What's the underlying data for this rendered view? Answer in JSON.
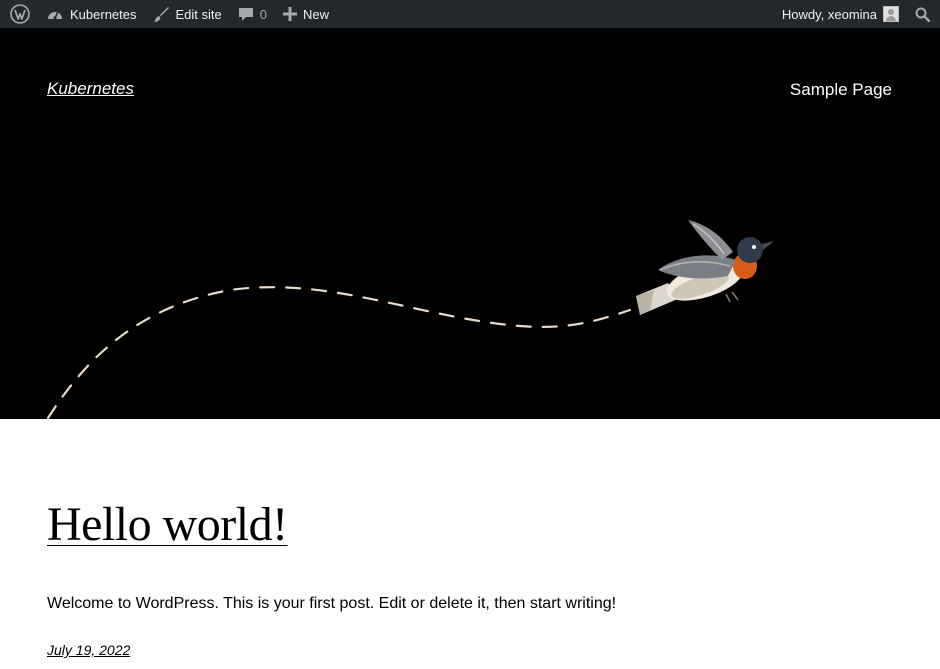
{
  "admin_bar": {
    "wp_logo_icon": "wordpress-logo-icon",
    "site_name": "Kubernetes",
    "site_icon": "dashboard-icon",
    "edit_site": "Edit site",
    "edit_icon": "brush-icon",
    "comments_count": "0",
    "comment_icon": "comment-icon",
    "new_label": "New",
    "new_icon": "plus-icon",
    "howdy": "Howdy, xeomina",
    "search_icon": "search-icon",
    "bar_color": "#23282d"
  },
  "header": {
    "site_title": "Kubernetes",
    "nav": [
      {
        "label": "Sample Page"
      }
    ],
    "background": "#000000",
    "path_color": "#e8d9c8"
  },
  "post": {
    "title": "Hello world!",
    "excerpt": "Welcome to WordPress. This is your first post. Edit or delete it, then start writing!",
    "date": "July 19, 2022"
  }
}
